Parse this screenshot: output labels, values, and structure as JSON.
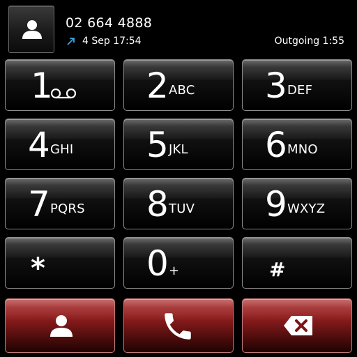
{
  "header": {
    "contact_photo_icon": "person-icon",
    "last_number": "02 664 4888",
    "call_direction_icon": "outgoing-arrow-icon",
    "call_direction_color": "#3aa6e8",
    "call_time": "4 Sep 17:54",
    "call_status": "Outgoing 1:55"
  },
  "keypad": {
    "keys": [
      {
        "digit": "1",
        "letters": "",
        "icon": "voicemail-icon"
      },
      {
        "digit": "2",
        "letters": "ABC"
      },
      {
        "digit": "3",
        "letters": "DEF"
      },
      {
        "digit": "4",
        "letters": "GHI"
      },
      {
        "digit": "5",
        "letters": "JKL"
      },
      {
        "digit": "6",
        "letters": "MNO"
      },
      {
        "digit": "7",
        "letters": "PQRS"
      },
      {
        "digit": "8",
        "letters": "TUV"
      },
      {
        "digit": "9",
        "letters": "WXYZ"
      },
      {
        "digit": "*",
        "letters": ""
      },
      {
        "digit": "0",
        "letters": "+"
      },
      {
        "digit": "#",
        "letters": ""
      }
    ]
  },
  "actions": {
    "contacts_icon": "person-icon",
    "call_icon": "phone-icon",
    "delete_icon": "backspace-icon",
    "accent": "#8e1d1d"
  }
}
